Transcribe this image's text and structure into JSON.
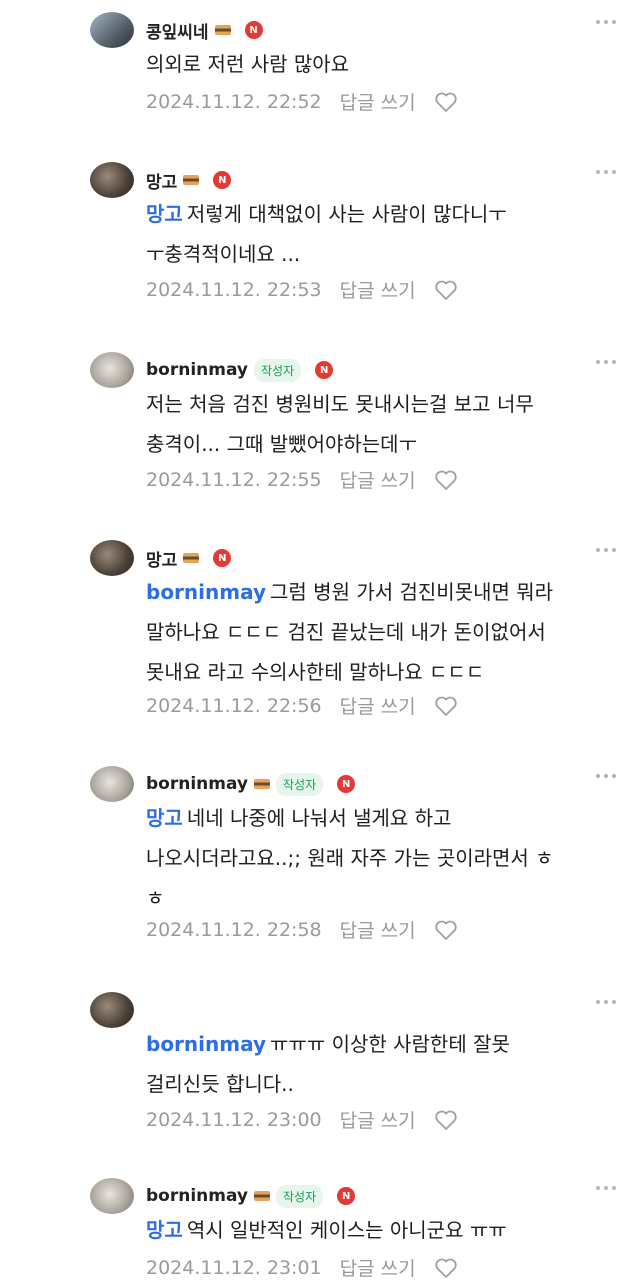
{
  "labels": {
    "author_badge": "작성자",
    "new_badge": "N",
    "reply_button": "답글 쓰기"
  },
  "comments": [
    {
      "nickname": "콩잎씨네",
      "is_author": false,
      "mention": "",
      "lines": [
        "의외로 저런 사람 많아요"
      ],
      "timestamp": "2024.11.12. 22:52"
    },
    {
      "nickname": "망고",
      "is_author": false,
      "mention": "",
      "lines": [
        "저렇게 대책없이 사는 사람이 많다니ㅜ",
        "ㅜ충격적이네요 ..."
      ],
      "timestamp": "2024.11.12. 22:53"
    },
    {
      "nickname": "borninmay",
      "is_author": true,
      "mention": "",
      "lines": [
        "저는 처음 검진 병원비도 못내시는걸 보고 너무",
        "충격이... 그때 발뺐어야하는데ㅜ"
      ],
      "timestamp": "2024.11.12. 22:55"
    },
    {
      "nickname": "망고",
      "is_author": false,
      "mention": "borninmay",
      "lines": [
        "그럼 병원 가서 검진비못내면 뭐라",
        "말하나요 ㄷㄷㄷ 검진 끝났는데 내가 돈이없어서",
        "못내요 라고 수의사한테 말하나요 ㄷㄷㄷ"
      ],
      "timestamp": "2024.11.12. 22:56"
    },
    {
      "nickname": "borninmay",
      "is_author": true,
      "mention": "망고",
      "lines": [
        "네네 나중에 나눠서 낼게요 하고",
        "나오시더라고요..;; 원래 자주 가는 곳이라면서 ㅎ",
        "ㅎ"
      ],
      "timestamp": "2024.11.12. 22:58"
    },
    {
      "nickname": "",
      "is_author": false,
      "mention": "borninmay",
      "lines": [
        "ㅠㅠㅠ 이상한 사람한테 잘못",
        "걸리신듯 합니다.."
      ],
      "timestamp": "2024.11.12. 23:00"
    },
    {
      "nickname": "borninmay",
      "is_author": true,
      "mention": "망고",
      "lines": [
        "역시 일반적인 케이스는 아니군요 ㅠㅠ"
      ],
      "timestamp": "2024.11.12. 23:01"
    }
  ]
}
